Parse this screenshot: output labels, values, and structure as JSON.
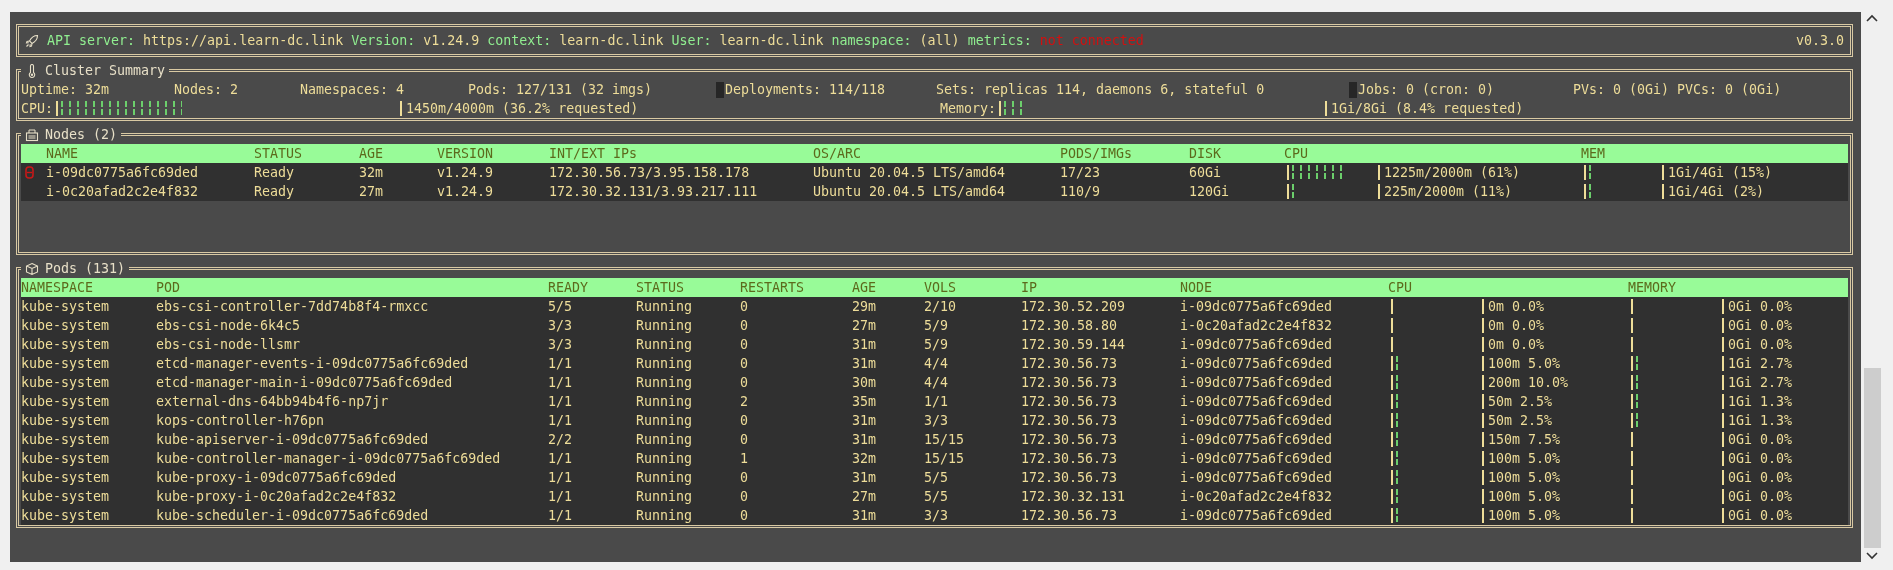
{
  "header": {
    "fields": [
      {
        "label": "API server:",
        "value": "https://api.learn-dc.link",
        "kind": "plain"
      },
      {
        "label": "Version:",
        "value": "v1.24.9",
        "kind": "plain"
      },
      {
        "label": "context:",
        "value": "learn-dc.link",
        "kind": "plain"
      },
      {
        "label": "User:",
        "value": "learn-dc.link",
        "kind": "plain"
      },
      {
        "label": "namespace:",
        "value": "(all)",
        "kind": "plain"
      },
      {
        "label": "metrics:",
        "value": "not connected",
        "kind": "alert"
      }
    ],
    "version": "v0.3.0"
  },
  "summary": {
    "title": "Cluster Summary",
    "stats": [
      {
        "text": "Uptime: 32m",
        "marker": false
      },
      {
        "text": "Nodes: 2",
        "marker": false
      },
      {
        "text": "Namespaces: 4",
        "marker": false
      },
      {
        "text": "Pods: 127/131 (32 imgs)",
        "marker": false
      },
      {
        "text": "Deployments: 114/118",
        "marker": true
      },
      {
        "text": "Sets: replicas 114, daemons 6, stateful 0",
        "marker": false
      },
      {
        "text": "Jobs: 0 (cron: 0)",
        "marker": true
      },
      {
        "text": "PVs: 0 (0Gi) PVCs: 0 (0Gi)",
        "marker": false
      }
    ],
    "meters": [
      {
        "label": "CPU:",
        "level": 0.362,
        "reading": "1450m/4000m (36.2% requested)"
      },
      {
        "label": "Memory:",
        "level": 0.084,
        "reading": "1Gi/8Gi (8.4% requested)"
      }
    ]
  },
  "nodes": {
    "title": "Nodes (2)",
    "columns": [
      "NAME",
      "STATUS",
      "AGE",
      "VERSION",
      "INT/EXT IPs",
      "OS/ARC",
      "PODS/IMGs",
      "DISK",
      "CPU",
      "MEM"
    ],
    "rows": [
      {
        "marked": true,
        "name": "i-09dc0775a6fc69ded",
        "status": "Ready",
        "age": "32m",
        "version": "v1.24.9",
        "ips": "172.30.56.73/3.95.158.178",
        "os": "Ubuntu 20.04.5 LTS/amd64",
        "pods": "17/23",
        "disk": "60Gi",
        "cpu": {
          "level": 0.61,
          "reading": "1225m/2000m (61%)"
        },
        "mem": {
          "level": 0.15,
          "reading": "1Gi/4Gi (15%)"
        }
      },
      {
        "marked": false,
        "name": "i-0c20afad2c2e4f832",
        "status": "Ready",
        "age": "27m",
        "version": "v1.24.9",
        "ips": "172.30.32.131/3.93.217.111",
        "os": "Ubuntu 20.04.5 LTS/amd64",
        "pods": "110/9",
        "disk": "120Gi",
        "cpu": {
          "level": 0.11,
          "reading": "225m/2000m (11%)"
        },
        "mem": {
          "level": 0.02,
          "reading": "1Gi/4Gi (2%)"
        }
      }
    ]
  },
  "pods": {
    "title": "Pods (131)",
    "columns": [
      "NAMESPACE",
      "POD",
      "READY",
      "STATUS",
      "RESTARTS",
      "AGE",
      "VOLS",
      "IP",
      "NODE",
      "CPU",
      "MEMORY"
    ],
    "rows": [
      {
        "namespace": "kube-system",
        "pod": "ebs-csi-controller-7dd74b8f4-rmxcc",
        "ready": "5/5",
        "status": "Running",
        "restarts": "0",
        "age": "29m",
        "vols": "2/10",
        "ip": "172.30.52.209",
        "node": "i-09dc0775a6fc69ded",
        "cpu": {
          "level": 0,
          "reading": "0m 0.0%"
        },
        "memory": {
          "level": 0,
          "reading": "0Gi 0.0%"
        }
      },
      {
        "namespace": "kube-system",
        "pod": "ebs-csi-node-6k4c5",
        "ready": "3/3",
        "status": "Running",
        "restarts": "0",
        "age": "27m",
        "vols": "5/9",
        "ip": "172.30.58.80",
        "node": "i-0c20afad2c2e4f832",
        "cpu": {
          "level": 0,
          "reading": "0m 0.0%"
        },
        "memory": {
          "level": 0,
          "reading": "0Gi 0.0%"
        }
      },
      {
        "namespace": "kube-system",
        "pod": "ebs-csi-node-llsmr",
        "ready": "3/3",
        "status": "Running",
        "restarts": "0",
        "age": "31m",
        "vols": "5/9",
        "ip": "172.30.59.144",
        "node": "i-09dc0775a6fc69ded",
        "cpu": {
          "level": 0,
          "reading": "0m 0.0%"
        },
        "memory": {
          "level": 0,
          "reading": "0Gi 0.0%"
        }
      },
      {
        "namespace": "kube-system",
        "pod": "etcd-manager-events-i-09dc0775a6fc69ded",
        "ready": "1/1",
        "status": "Running",
        "restarts": "0",
        "age": "31m",
        "vols": "4/4",
        "ip": "172.30.56.73",
        "node": "i-09dc0775a6fc69ded",
        "cpu": {
          "level": 0.05,
          "reading": "100m 5.0%"
        },
        "memory": {
          "level": 0.027,
          "reading": "1Gi 2.7%"
        }
      },
      {
        "namespace": "kube-system",
        "pod": "etcd-manager-main-i-09dc0775a6fc69ded",
        "ready": "1/1",
        "status": "Running",
        "restarts": "0",
        "age": "30m",
        "vols": "4/4",
        "ip": "172.30.56.73",
        "node": "i-09dc0775a6fc69ded",
        "cpu": {
          "level": 0.1,
          "reading": "200m 10.0%"
        },
        "memory": {
          "level": 0.027,
          "reading": "1Gi 2.7%"
        }
      },
      {
        "namespace": "kube-system",
        "pod": "external-dns-64bb94b4f6-np7jr",
        "ready": "1/1",
        "status": "Running",
        "restarts": "2",
        "age": "35m",
        "vols": "1/1",
        "ip": "172.30.56.73",
        "node": "i-09dc0775a6fc69ded",
        "cpu": {
          "level": 0.025,
          "reading": "50m 2.5%"
        },
        "memory": {
          "level": 0.013,
          "reading": "1Gi 1.3%"
        }
      },
      {
        "namespace": "kube-system",
        "pod": "kops-controller-h76pn",
        "ready": "1/1",
        "status": "Running",
        "restarts": "0",
        "age": "31m",
        "vols": "3/3",
        "ip": "172.30.56.73",
        "node": "i-09dc0775a6fc69ded",
        "cpu": {
          "level": 0.025,
          "reading": "50m 2.5%"
        },
        "memory": {
          "level": 0.013,
          "reading": "1Gi 1.3%"
        }
      },
      {
        "namespace": "kube-system",
        "pod": "kube-apiserver-i-09dc0775a6fc69ded",
        "ready": "2/2",
        "status": "Running",
        "restarts": "0",
        "age": "31m",
        "vols": "15/15",
        "ip": "172.30.56.73",
        "node": "i-09dc0775a6fc69ded",
        "cpu": {
          "level": 0.075,
          "reading": "150m 7.5%"
        },
        "memory": {
          "level": 0,
          "reading": "0Gi 0.0%"
        }
      },
      {
        "namespace": "kube-system",
        "pod": "kube-controller-manager-i-09dc0775a6fc69ded",
        "ready": "1/1",
        "status": "Running",
        "restarts": "1",
        "age": "32m",
        "vols": "15/15",
        "ip": "172.30.56.73",
        "node": "i-09dc0775a6fc69ded",
        "cpu": {
          "level": 0.05,
          "reading": "100m 5.0%"
        },
        "memory": {
          "level": 0,
          "reading": "0Gi 0.0%"
        }
      },
      {
        "namespace": "kube-system",
        "pod": "kube-proxy-i-09dc0775a6fc69ded",
        "ready": "1/1",
        "status": "Running",
        "restarts": "0",
        "age": "31m",
        "vols": "5/5",
        "ip": "172.30.56.73",
        "node": "i-09dc0775a6fc69ded",
        "cpu": {
          "level": 0.05,
          "reading": "100m 5.0%"
        },
        "memory": {
          "level": 0,
          "reading": "0Gi 0.0%"
        }
      },
      {
        "namespace": "kube-system",
        "pod": "kube-proxy-i-0c20afad2c2e4f832",
        "ready": "1/1",
        "status": "Running",
        "restarts": "0",
        "age": "27m",
        "vols": "5/5",
        "ip": "172.30.32.131",
        "node": "i-0c20afad2c2e4f832",
        "cpu": {
          "level": 0.05,
          "reading": "100m 5.0%"
        },
        "memory": {
          "level": 0,
          "reading": "0Gi 0.0%"
        }
      },
      {
        "namespace": "kube-system",
        "pod": "kube-scheduler-i-09dc0775a6fc69ded",
        "ready": "1/1",
        "status": "Running",
        "restarts": "0",
        "age": "31m",
        "vols": "3/3",
        "ip": "172.30.56.73",
        "node": "i-09dc0775a6fc69ded",
        "cpu": {
          "level": 0.05,
          "reading": "100m 5.0%"
        },
        "memory": {
          "level": 0,
          "reading": "0Gi 0.0%"
        }
      }
    ]
  }
}
